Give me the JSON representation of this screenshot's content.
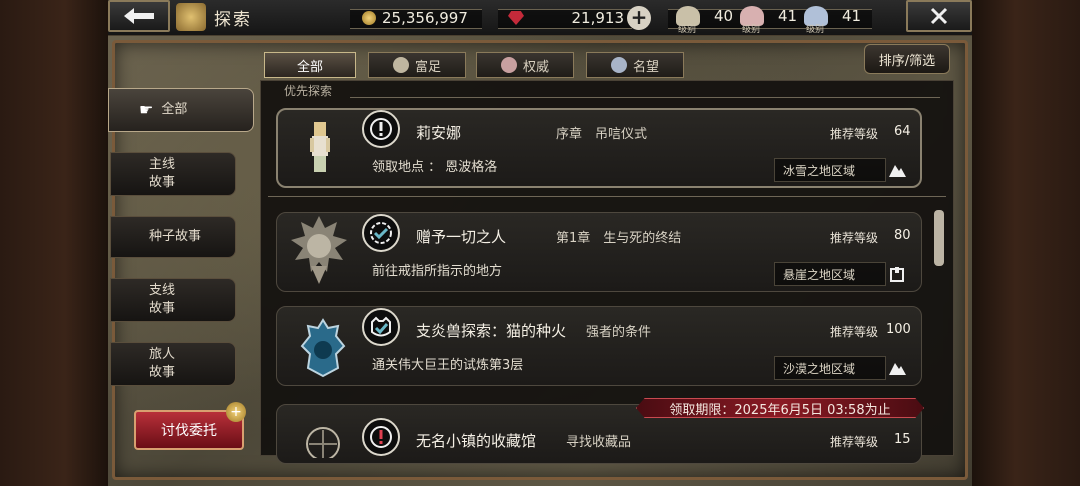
{
  "header": {
    "title": "探索",
    "gold": "25,356,997",
    "gems": "21,913",
    "levels": [
      {
        "value": "40",
        "caption": "级别",
        "color": "#c9c0a8"
      },
      {
        "value": "41",
        "caption": "级别",
        "color": "#d8b0b0"
      },
      {
        "value": "41",
        "caption": "级别",
        "color": "#b0c0d8"
      }
    ]
  },
  "tabs": [
    {
      "label": "全部",
      "icon": "none"
    },
    {
      "label": "富足",
      "icon": "wealth-icon"
    },
    {
      "label": "权威",
      "icon": "power-icon"
    },
    {
      "label": "名望",
      "icon": "fame-icon"
    }
  ],
  "sort_label": "排序/筛选",
  "sidebar": {
    "items": [
      {
        "label": "全部"
      },
      {
        "label": "主线\n故事"
      },
      {
        "label": "种子故事"
      },
      {
        "label": "支线\n故事"
      },
      {
        "label": "旅人\n故事"
      }
    ],
    "commission": "讨伐委托"
  },
  "section_title": "优先探索",
  "quests": [
    {
      "title": "莉安娜",
      "chapter": "序章　吊唁仪式",
      "rec_label": "推荐等级",
      "level": "64",
      "sub": "领取地点 ： 恩波格洛",
      "region": "冰雪之地区域",
      "emblem": "exclamation-icon"
    },
    {
      "title": "赠予一切之人",
      "chapter": "第1章　生与死的终结",
      "rec_label": "推荐等级",
      "level": "80",
      "sub": "前往戒指所指示的地方",
      "region": "悬崖之地区域",
      "emblem": "check-icon"
    },
    {
      "title": "支炎兽探索：猫的种火",
      "chapter": "强者的条件",
      "rec_label": "推荐等级",
      "level": "100",
      "sub": "通关伟大巨王的试炼第3层",
      "region": "沙漠之地区域",
      "emblem": "cat-check-icon"
    },
    {
      "title": "无名小镇的收藏馆",
      "chapter": "寻找收藏品",
      "rec_label": "推荐等级",
      "level": "15",
      "sub": "",
      "region": "",
      "emblem": "locked-exclamation-icon"
    }
  ],
  "deadline": "领取期限：2025年6月5日 03:58为止"
}
